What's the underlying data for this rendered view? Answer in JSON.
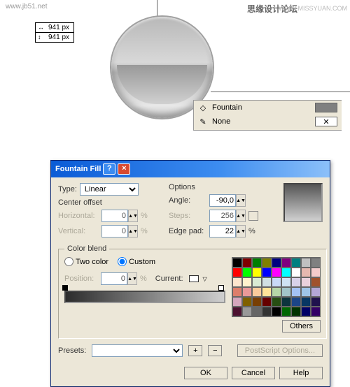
{
  "watermarks": {
    "left": "www.jb51.net",
    "center": "思缘设计论坛",
    "right": "WWW.MISSYUAN.COM"
  },
  "dimensions": {
    "width": "941 px",
    "height": "941 px"
  },
  "fillpanel": {
    "fill_label": "Fountain",
    "outline_label": "None",
    "fill_color": "#808080"
  },
  "dialog": {
    "title": "Fountain Fill",
    "type_label": "Type:",
    "type_value": "Linear",
    "center_offset_label": "Center offset",
    "horizontal_label": "Horizontal:",
    "horizontal_value": "0",
    "vertical_label": "Vertical:",
    "vertical_value": "0",
    "options_label": "Options",
    "angle_label": "Angle:",
    "angle_value": "-90,0",
    "steps_label": "Steps:",
    "steps_value": "256",
    "edgepad_label": "Edge pad:",
    "edgepad_value": "22",
    "pct": "%",
    "color_blend_label": "Color blend",
    "twocolor_label": "Two color",
    "custom_label": "Custom",
    "position_label": "Position:",
    "position_value": "0",
    "current_label": "Current:",
    "others_label": "Others",
    "presets_label": "Presets:",
    "presets_value": "",
    "postscript_label": "PostScript Options...",
    "ok": "OK",
    "cancel": "Cancel",
    "help": "Help"
  },
  "palette": [
    "#000000",
    "#800000",
    "#008000",
    "#808000",
    "#000080",
    "#800080",
    "#008080",
    "#c0c0c0",
    "#808080",
    "#ff0000",
    "#00ff00",
    "#ffff00",
    "#0000ff",
    "#ff00ff",
    "#00ffff",
    "#ffffff",
    "#e6b8af",
    "#f4cccc",
    "#fce5cd",
    "#fff2cc",
    "#d9ead3",
    "#d0e0e3",
    "#c9daf8",
    "#cfe2f3",
    "#d9d2e9",
    "#ead1dc",
    "#a0522d",
    "#dd7e6b",
    "#ea9999",
    "#f9cb9c",
    "#ffe599",
    "#b6d7a8",
    "#a2c4c9",
    "#a4c2f4",
    "#9fc5e8",
    "#b4a7d6",
    "#d5a6bd",
    "#7f6000",
    "#783f04",
    "#660000",
    "#274e13",
    "#0c343d",
    "#1c4587",
    "#073763",
    "#20124d",
    "#4c1130",
    "#999999",
    "#666666",
    "#333333",
    "#000000",
    "#006600",
    "#003300",
    "#000066",
    "#330066"
  ]
}
